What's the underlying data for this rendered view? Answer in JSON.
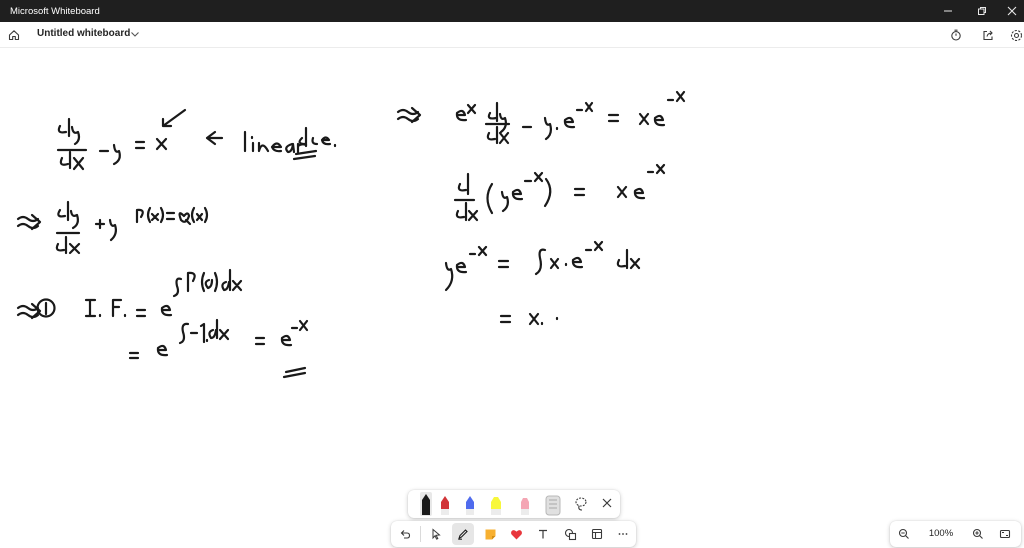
{
  "window": {
    "title": "Microsoft Whiteboard"
  },
  "appbar": {
    "board_title": "Untitled whiteboard"
  },
  "zoom": {
    "level": "100%"
  },
  "icons": {
    "home": "home-icon",
    "chevron": "chevron-down-icon",
    "timer": "timer-icon",
    "share": "share-icon",
    "settings": "gear-icon",
    "undo": "undo-icon",
    "select": "select-arrow-icon",
    "ink": "pen-icon",
    "sticky": "sticky-note-icon",
    "reactions": "heart-icon",
    "text": "text-icon",
    "shapes": "shapes-icon",
    "templates": "templates-icon",
    "more": "more-icon",
    "lasso": "lasso-icon",
    "close": "close-icon",
    "zoom_out": "zoom-out-icon",
    "zoom_in": "zoom-in-icon",
    "fit": "fit-to-screen-icon"
  },
  "pens": [
    {
      "name": "black-pen",
      "color": "#1a1a1a"
    },
    {
      "name": "red-pen",
      "color": "#d13438"
    },
    {
      "name": "blue-pen",
      "color": "#4f6bed"
    },
    {
      "name": "yellow-highlighter",
      "color": "#f7f73b"
    },
    {
      "name": "pink-highlighter",
      "color": "#f4a6b4"
    },
    {
      "name": "ruler",
      "color": "#c8c8c8"
    }
  ],
  "colors": {
    "titlebar": "#1f1f1f",
    "ink": "#1a1a1a",
    "sticky": "#f7b030",
    "heart": "#e8363c"
  }
}
